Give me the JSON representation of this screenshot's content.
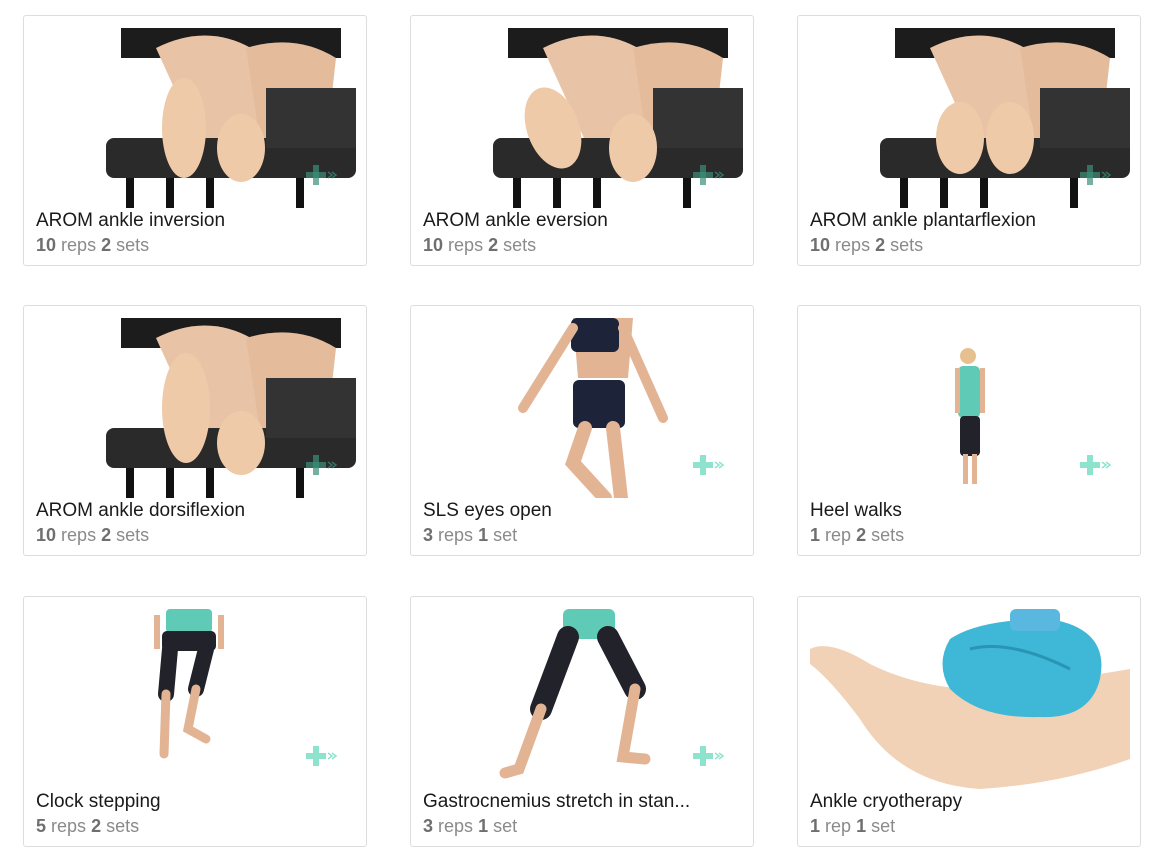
{
  "accent_color": "#8ee3cf",
  "cards": [
    {
      "title": "AROM ankle inversion",
      "n1": "10",
      "u1": "reps",
      "n2": "2",
      "u2": "sets",
      "image": "feet-on-table"
    },
    {
      "title": "AROM ankle eversion",
      "n1": "10",
      "u1": "reps",
      "n2": "2",
      "u2": "sets",
      "image": "feet-on-table"
    },
    {
      "title": "AROM ankle plantarflexion",
      "n1": "10",
      "u1": "reps",
      "n2": "2",
      "u2": "sets",
      "image": "feet-on-table"
    },
    {
      "title": "AROM ankle dorsiflexion",
      "n1": "10",
      "u1": "reps",
      "n2": "2",
      "u2": "sets",
      "image": "feet-on-table"
    },
    {
      "title": "SLS eyes open",
      "n1": "3",
      "u1": "reps",
      "n2": "1",
      "u2": "set",
      "image": "woman-single-leg-stance"
    },
    {
      "title": "Heel walks",
      "n1": "1",
      "u1": "rep",
      "n2": "2",
      "u2": "sets",
      "image": "woman-standing"
    },
    {
      "title": "Clock stepping",
      "n1": "5",
      "u1": "reps",
      "n2": "2",
      "u2": "sets",
      "image": "legs-stepping"
    },
    {
      "title": "Gastrocnemius stretch in stan...",
      "n1": "3",
      "u1": "reps",
      "n2": "1",
      "u2": "set",
      "image": "legs-calf-stretch"
    },
    {
      "title": "Ankle cryotherapy",
      "n1": "1",
      "u1": "rep",
      "n2": "1",
      "u2": "set",
      "image": "ice-bag-on-foot"
    }
  ]
}
